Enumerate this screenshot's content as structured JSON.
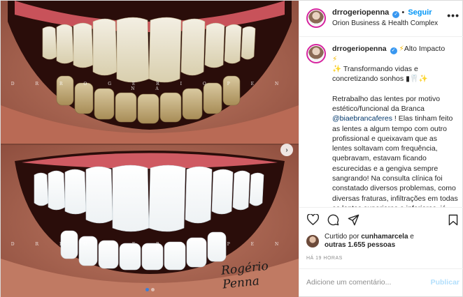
{
  "header": {
    "username": "drrogeriopenna",
    "follow_label": "Seguir",
    "location": "Orion Business & Health Complex",
    "more_label": "•••"
  },
  "media": {
    "watermark": "D R R O G E R I O P E N N A",
    "signature": "Rogério Penna",
    "slide_count": 2,
    "active_slide": 1
  },
  "caption": {
    "username": "drrogeriopenna",
    "headline": "Alto Impacto",
    "tagline": "Transformando vidas e concretizando sonhos",
    "body_before_mention": "Retrabalho das lentes por motivo estético/funcional da Branca ",
    "mention": "@biaebrancaferes",
    "body_after_mention": " ! Elas tinham feito as lentes a algum tempo com outro profissional e queixavam que as lentes soltavam com frequência, quebravam, estavam ficando escurecidas e a gengiva sempre sangrando! Na consulta clínica foi constatado diversos problemas, como diversas fraturas, infiltrações em todas as lentes superiores e inferiores, já com cárie em diversos dentes, sem preparos adequados, um quadro de"
  },
  "likes": {
    "prefix": "Curtido por ",
    "first_user": "cunhamarcela",
    "middle": " e",
    "others": "outras 1.655 pessoas"
  },
  "timestamp": "HÁ 19 HORAS",
  "comment": {
    "placeholder": "Adicione um comentário...",
    "publish_label": "Publicar"
  },
  "colors": {
    "accent": "#0095f6",
    "verified": "#3897f0",
    "publish_disabled": "#b2dffc"
  }
}
